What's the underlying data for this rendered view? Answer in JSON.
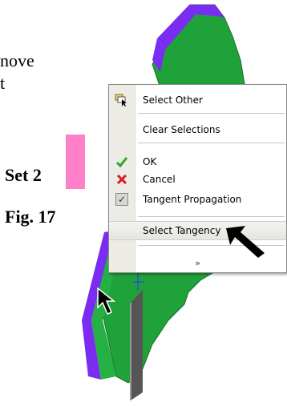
{
  "doc_text": {
    "line1": "nove",
    "line2": "t"
  },
  "labels": {
    "set": "Set 2",
    "figure": "Fig. 17"
  },
  "colors": {
    "swatch": "#ff7fc8",
    "face_green": "#1fa23a",
    "edge_purple": "#7a2cf0",
    "menu_gutter": "#ecebe6"
  },
  "context_menu": {
    "items": [
      {
        "label": "Select Other",
        "icon": "select-other-icon"
      },
      {
        "label": "Clear Selections",
        "icon": ""
      },
      {
        "label": "OK",
        "icon": "green-check-icon"
      },
      {
        "label": "Cancel",
        "icon": "red-x-icon"
      },
      {
        "label": "Tangent Propagation",
        "icon": "checkbox-checked-icon",
        "checked": true
      },
      {
        "label": "Select Tangency",
        "icon": "",
        "highlighted": true
      }
    ],
    "expand_glyph": "»"
  }
}
